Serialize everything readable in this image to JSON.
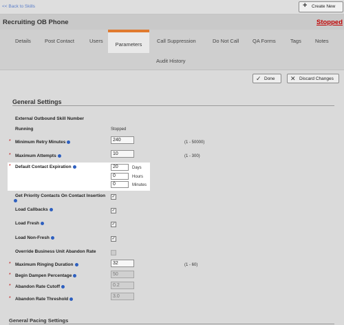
{
  "header": {
    "back_link": "<< Back to Skills",
    "create_new_label": "Create New",
    "title": "Recruiting OB Phone",
    "status": "Stopped"
  },
  "tabs": [
    {
      "label": "Details"
    },
    {
      "label": "Post Contact"
    },
    {
      "label": "Users"
    },
    {
      "label": "Parameters",
      "active": true
    },
    {
      "label": "Call Suppression"
    },
    {
      "label": "Do Not Call"
    },
    {
      "label": "QA Forms"
    },
    {
      "label": "Tags"
    },
    {
      "label": "Notes"
    },
    {
      "label": "Audit History"
    }
  ],
  "actions": {
    "done_label": "Done",
    "discard_label": "Discard Changes"
  },
  "general": {
    "title": "General Settings",
    "external_skill_label": "External Outbound Skill Number",
    "running_label": "Running",
    "running_value": "Stopped",
    "min_retry_label": "Minimum Retry Minutes",
    "min_retry_value": "240",
    "min_retry_range": "(1 - 50000)",
    "max_attempts_label": "Maximum Attempts",
    "max_attempts_value": "10",
    "max_attempts_range": "(1 - 300)",
    "expiration_label": "Default Contact Expiration",
    "expiration_days": "20",
    "expiration_hours": "0",
    "expiration_minutes": "0",
    "days_unit": "Days",
    "hours_unit": "Hours",
    "minutes_unit": "Minutes",
    "priority_label": "Get Priority Contacts On Contact Insertion",
    "priority_checked": true,
    "load_callbacks_label": "Load Callbacks",
    "load_callbacks_checked": true,
    "load_fresh_label": "Load Fresh",
    "load_fresh_checked": true,
    "load_nonfresh_label": "Load Non-Fresh",
    "load_nonfresh_checked": true,
    "override_label": "Override Business Unit Abandon Rate",
    "override_checked": false,
    "max_ringing_label": "Maximum Ringing Duration",
    "max_ringing_value": "32",
    "max_ringing_range": "(1 - 60)",
    "dampen_label": "Begin Dampen Percentage",
    "dampen_value": "50",
    "abandon_cutoff_label": "Abandon Rate Cutoff",
    "abandon_cutoff_value": "0.2",
    "abandon_threshold_label": "Abandon Rate Threshold",
    "abandon_threshold_value": "3.0"
  },
  "pacing": {
    "title": "General Pacing Settings"
  },
  "icons": {
    "check_glyph": "✓",
    "plus_glyph": "+",
    "close_glyph": "✕",
    "required_mark": "*"
  },
  "colors": {
    "accent": "#e07a2f",
    "status": "#c00000",
    "info": "#2d5fbf",
    "link": "#5b7ec9"
  }
}
